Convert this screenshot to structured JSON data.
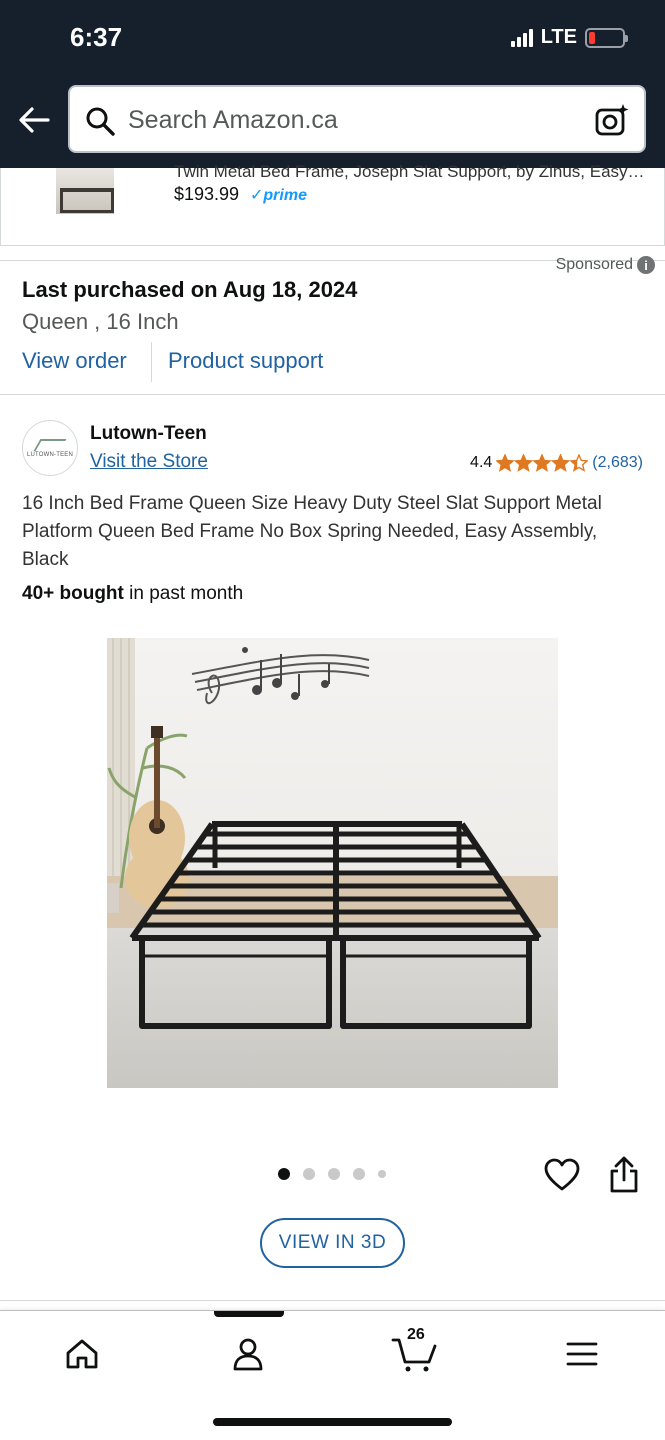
{
  "status_bar": {
    "time": "6:37",
    "network": "LTE"
  },
  "header": {
    "search_placeholder": "Search Amazon.ca"
  },
  "previous_item": {
    "title": "Twin Metal Bed Frame, Joseph Slat Support, by Zinus, Easy…",
    "price": "$193.99",
    "badge": "prime"
  },
  "sponsored_label": "Sponsored",
  "purchase_info": {
    "headline": "Last purchased on Aug 18, 2024",
    "variant": "Queen , 16 Inch",
    "view_order_label": "View order",
    "product_support_label": "Product support"
  },
  "product": {
    "brand": "Lutown-Teen",
    "brand_logo_text": "LUTOWN-TEEN",
    "visit_store_label": "Visit the Store",
    "rating": "4.4",
    "stars_fraction": 0.88,
    "review_count": "(2,683)",
    "title": "16 Inch Bed Frame Queen Size Heavy Duty Steel Slat Support Metal Platform Queen Bed Frame No Box Spring Needed, Easy Assembly, Black",
    "bought_count": "40+ bought",
    "bought_suffix": " in past month",
    "image_count": 5,
    "active_image": 1,
    "view_3d_label": "VIEW IN 3D"
  },
  "tabbar": {
    "cart_count": "26",
    "tabs": [
      "home",
      "account",
      "cart",
      "menu"
    ]
  },
  "colors": {
    "header_bg": "#16202c",
    "link": "#2162a1",
    "star": "#de7921",
    "prime": "#1399ff"
  }
}
